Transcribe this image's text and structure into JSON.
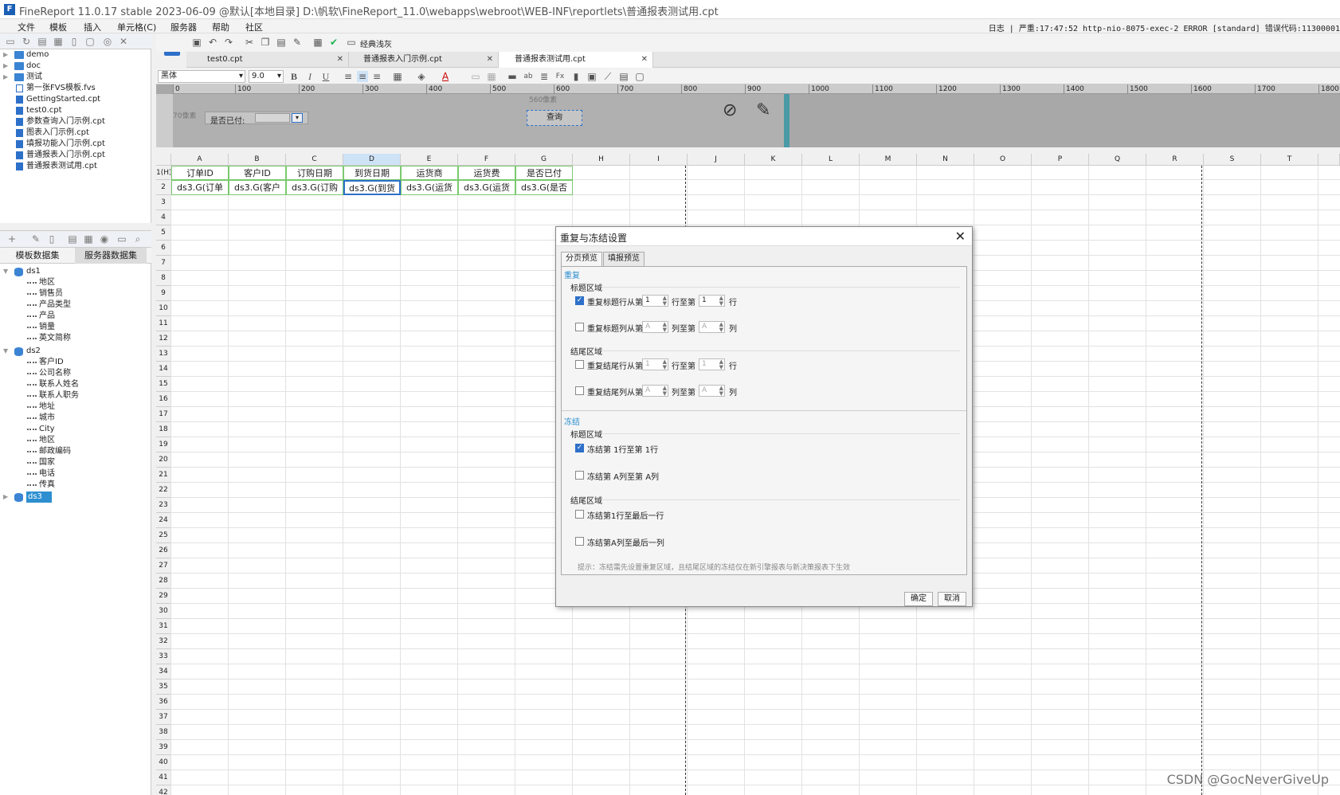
{
  "title": "FineReport 11.0.17 stable 2023-06-09 @默认[本地目录]    D:\\帆软\\FineReport_11.0\\webapps\\webroot\\WEB-INF\\reportlets\\普通报表测试用.cpt",
  "menu": [
    "文件",
    "模板",
    "插入",
    "单元格(C)",
    "服务器",
    "帮助",
    "社区"
  ],
  "log_text": "日志 | 严重:17:47:52 http-nio-8075-exec-2 ERROR [standard] 错误代码:11300001",
  "file_tree": [
    "demo",
    "doc",
    "测试",
    "第一张FVS模板.fvs",
    "GettingStarted.cpt",
    "test0.cpt",
    "参数查询入门示例.cpt",
    "图表入门示例.cpt",
    "填报功能入门示例.cpt",
    "普通报表入门示例.cpt",
    "普通报表测试用.cpt"
  ],
  "dataset_tabs": [
    "模板数据集",
    "服务器数据集"
  ],
  "datasets": [
    {
      "name": "ds1",
      "fields": [
        "地区",
        "销售员",
        "产品类型",
        "产品",
        "销量",
        "英文简称"
      ]
    },
    {
      "name": "ds2",
      "fields": [
        "客户ID",
        "公司名称",
        "联系人姓名",
        "联系人职务",
        "地址",
        "城市",
        "City",
        "地区",
        "邮政编码",
        "国家",
        "电话",
        "传真"
      ]
    },
    {
      "name": "ds3",
      "fields": []
    }
  ],
  "toolbar_label": "经典浅灰",
  "doc_tabs": [
    "test0.cpt",
    "普通报表入门示例.cpt",
    "普通报表测试用.cpt"
  ],
  "font_name": "黑体",
  "font_size": "9.0",
  "fmt_bold": "B",
  "fmt_italic": "I",
  "fmt_underline": "U",
  "ruler_ticks": [
    "0",
    "100",
    "200",
    "300",
    "400",
    "500",
    "600",
    "700",
    "800",
    "900",
    "1000",
    "1100",
    "1200",
    "1300",
    "1400",
    "1500",
    "1600",
    "1700",
    "1800"
  ],
  "param": {
    "width_label": "70像素",
    "paid_label": "是否已付:",
    "px_label": "560像素",
    "query_button": "查询"
  },
  "columns": [
    "A",
    "B",
    "C",
    "D",
    "E",
    "F",
    "G",
    "H",
    "I",
    "J",
    "K",
    "L",
    "M",
    "N",
    "O",
    "P",
    "Q",
    "R",
    "S",
    "T"
  ],
  "header_row": [
    "订单ID",
    "客户ID",
    "订购日期",
    "到货日期",
    "运货商",
    "运货费",
    "是否已付"
  ],
  "data_row": [
    "ds3.G(订单",
    "ds3.G(客户",
    "ds3.G(订购",
    "ds3.G(到货",
    "ds3.G(运货",
    "ds3.G(运货",
    "ds3.G(是否"
  ],
  "row_labels": [
    "1(H)",
    "2",
    "3",
    "4",
    "5",
    "6",
    "7",
    "8",
    "9",
    "10",
    "11",
    "12",
    "13",
    "14",
    "15",
    "16",
    "17",
    "18",
    "19",
    "20",
    "21",
    "22",
    "23",
    "24",
    "25",
    "26",
    "27",
    "28",
    "29",
    "30",
    "31",
    "32",
    "33",
    "34",
    "35",
    "36",
    "37",
    "38",
    "39",
    "40",
    "41",
    "42"
  ],
  "dialog": {
    "title": "重复与冻结设置",
    "tabs": [
      "分页预览",
      "填报预览"
    ],
    "repeat_label": "重复",
    "title_area": "标题区域",
    "tail_area": "结尾区域",
    "opt_repeat_title_row": "重复标题行从第",
    "row_to": "行至第",
    "row_unit": "行",
    "opt_repeat_title_col": "重复标题列从第",
    "col_to": "列至第",
    "col_unit": "列",
    "opt_repeat_tail_row": "重复结尾行从第",
    "opt_repeat_tail_col": "重复结尾列从第",
    "val_1": "1",
    "val_A": "A",
    "freeze_label": "冻结",
    "opt_freeze_row": "冻结第 1行至第 1行",
    "opt_freeze_col": "冻结第 A列至第 A列",
    "opt_freeze_tail_row": "冻结第1行至最后一行",
    "opt_freeze_tail_col": "冻结第A列至最后一列",
    "hint": "提示：冻结需先设置重复区域，且结尾区域的冻结仅在新引擎报表与新决策报表下生效",
    "ok": "确定",
    "cancel": "取消"
  },
  "watermark": "CSDN @GocNeverGiveUp"
}
